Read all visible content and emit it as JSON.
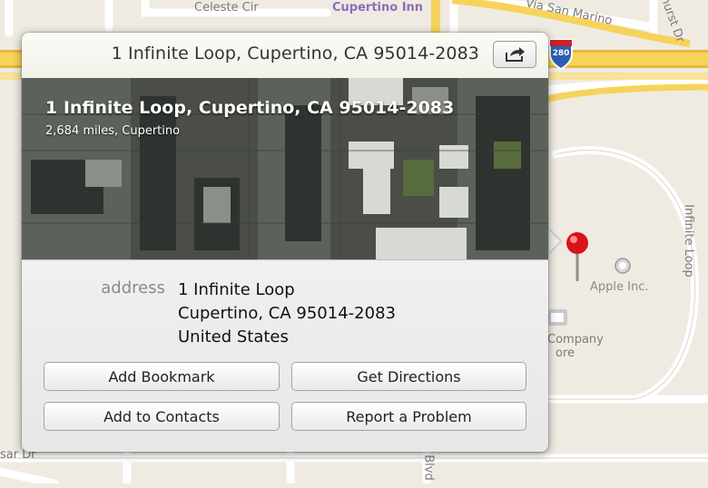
{
  "map": {
    "streets": {
      "celeste": "Celeste Cir",
      "san_marino": "Via San Marino",
      "bathurst": "hurst Dr",
      "infinite_loop": "Infinite Loop",
      "blvd": "Blvd",
      "bottom_left": "sar Dr"
    },
    "pois": {
      "cupertino_inn": "Cupertino Inn",
      "apple": "Apple Inc.",
      "company_store_1": "Company",
      "company_store_2": "ore"
    },
    "highway_shield": "280",
    "pin_color": "#d8141a"
  },
  "popover": {
    "title": "1 Infinite Loop, Cupertino, CA  95014-2083",
    "share_icon": "share-icon",
    "aerial_title": "1 Infinite Loop, Cupertino, CA  95014-2083",
    "aerial_subtitle": "2,684 miles, Cupertino",
    "address_label": "address",
    "address_lines": [
      "1 Infinite Loop",
      "Cupertino, CA  95014-2083",
      "United States"
    ],
    "buttons": {
      "add_bookmark": "Add Bookmark",
      "get_directions": "Get Directions",
      "add_to_contacts": "Add to Contacts",
      "report_problem": "Report a Problem"
    }
  }
}
